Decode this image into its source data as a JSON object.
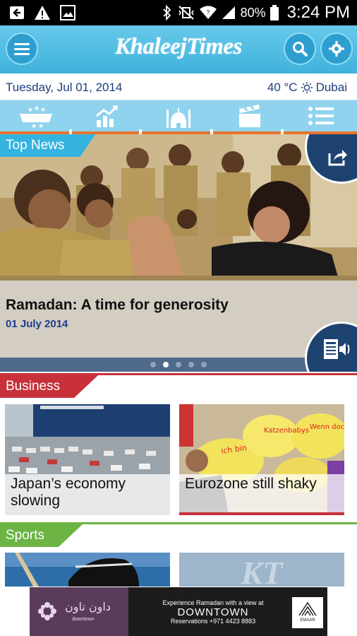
{
  "status_bar": {
    "battery": "80%",
    "time": "3:24 PM"
  },
  "header": {
    "logo": "KhaleejTimes"
  },
  "date_row": {
    "date": "Tuesday, Jul 01, 2014",
    "temperature": "40 °C",
    "city": "Dubai"
  },
  "categories": [
    "home-stars",
    "markets",
    "religion",
    "entertainment",
    "menu-list"
  ],
  "top_news": {
    "tag": "Top News",
    "headline": "Ramadan: A time for generosity",
    "date": "01 July 2014",
    "slides": 5,
    "active_slide": 2
  },
  "business": {
    "tag": "Business",
    "cards": [
      {
        "caption": "Japan’s economy slowing"
      },
      {
        "caption": "Eurozone still shaky"
      }
    ]
  },
  "sports": {
    "tag": "Sports"
  },
  "ad": {
    "brand_arabic": "داون تاون",
    "brand_english": "downtown",
    "line1": "Experience Ramadan with a view at",
    "line2": "DOWNTOWN",
    "line3": "Reservations +971 4423 8883",
    "sponsor": "EMAAR"
  },
  "colors": {
    "accent_blue": "#3fb2dc",
    "business_red": "#c8313a",
    "sports_green": "#6cb544",
    "nav_orange": "#e9742e",
    "dark_navy": "#1e4370"
  }
}
